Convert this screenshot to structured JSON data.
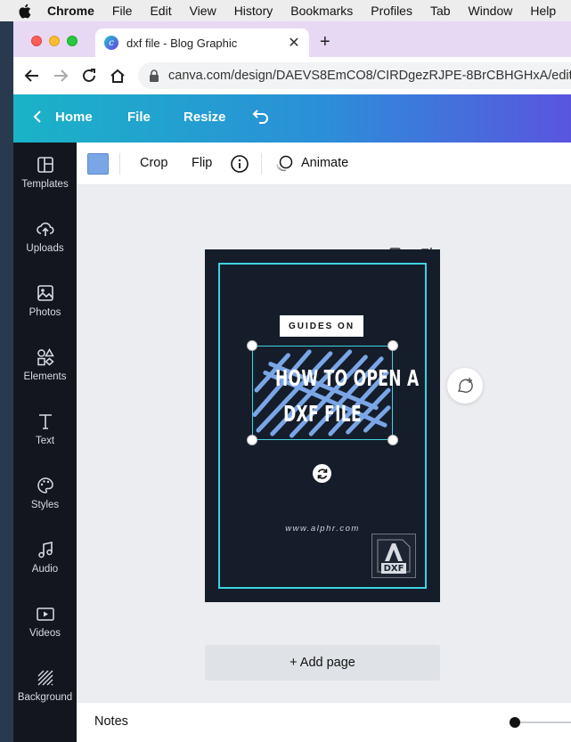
{
  "menubar": {
    "items": [
      "Chrome",
      "File",
      "Edit",
      "View",
      "History",
      "Bookmarks",
      "Profiles",
      "Tab",
      "Window",
      "Help"
    ]
  },
  "browser": {
    "tab_title": "dxf file - Blog Graphic",
    "favicon_letter": "c",
    "tab_close": "✕",
    "new_tab": "+",
    "url": "canva.com/design/DAEVS8EmCO8/CIRDgezRJPE-8BrCBHGHxA/edit"
  },
  "canva_header": {
    "home": "Home",
    "file": "File",
    "resize": "Resize"
  },
  "sidebar": {
    "items": [
      {
        "label": "Templates",
        "icon": "templates-icon"
      },
      {
        "label": "Uploads",
        "icon": "upload-cloud-icon"
      },
      {
        "label": "Photos",
        "icon": "photo-icon"
      },
      {
        "label": "Elements",
        "icon": "shapes-icon"
      },
      {
        "label": "Text",
        "icon": "text-t-icon"
      },
      {
        "label": "Styles",
        "icon": "palette-icon"
      },
      {
        "label": "Audio",
        "icon": "music-note-icon"
      },
      {
        "label": "Videos",
        "icon": "video-play-icon"
      },
      {
        "label": "Background",
        "icon": "hatch-pattern-icon"
      }
    ]
  },
  "context_toolbar": {
    "color": "#7aa6e6",
    "crop": "Crop",
    "flip": "Flip",
    "animate": "Animate"
  },
  "design": {
    "badge": "GUIDES ON",
    "headline_line1": "HOW TO OPEN A",
    "headline_line2": "DXF FILE",
    "website": "www.alphr.com",
    "logo_text": "DXF",
    "background_color": "#151d2b",
    "accent_color": "#3fd3df",
    "scribble_color": "#7aa6e6"
  },
  "canvas": {
    "add_page": "+ Add page"
  },
  "notes": {
    "label": "Notes"
  }
}
